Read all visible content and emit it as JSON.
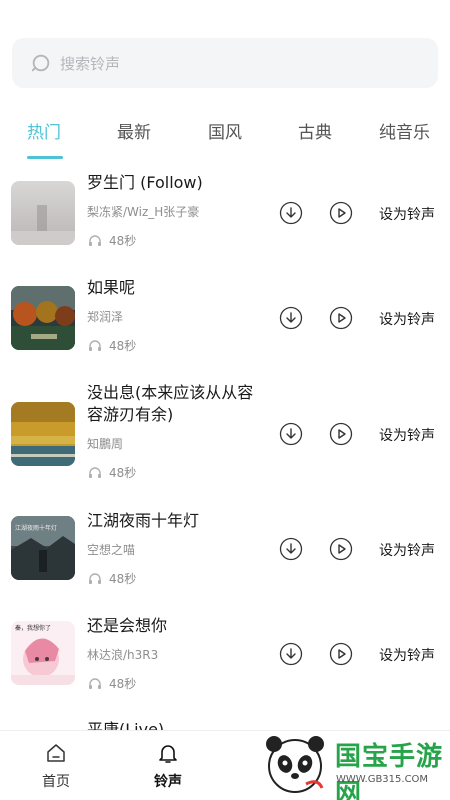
{
  "search": {
    "placeholder": "搜索铃声"
  },
  "tabs": [
    {
      "label": "热门",
      "active": true
    },
    {
      "label": "最新",
      "active": false
    },
    {
      "label": "国风",
      "active": false
    },
    {
      "label": "古典",
      "active": false
    },
    {
      "label": "纯音乐",
      "active": false
    }
  ],
  "songs": [
    {
      "title": "罗生门 (Follow)",
      "artist": "梨冻紧/Wiz_H张子豪",
      "duration": "48秒",
      "action": "设为铃声"
    },
    {
      "title": "如果呢",
      "artist": "郑润泽",
      "duration": "48秒",
      "action": "设为铃声"
    },
    {
      "title": "没出息(本来应该从从容容游刃有余)",
      "artist": "知鵬周",
      "duration": "48秒",
      "action": "设为铃声"
    },
    {
      "title": "江湖夜雨十年灯",
      "artist": "空想之喵",
      "duration": "48秒",
      "action": "设为铃声"
    },
    {
      "title": "还是会想你",
      "artist": "林达浪/h3R3",
      "duration": "48秒",
      "action": "设为铃声"
    }
  ],
  "partial_item": {
    "title": "平康(Live)"
  },
  "cover_text": {
    "song4": "江湖夜雨十年灯",
    "song5": "秦，我想你了"
  },
  "bottom_nav": [
    {
      "label": "首页",
      "icon": "home-icon"
    },
    {
      "label": "铃声",
      "icon": "bell-icon"
    }
  ],
  "watermark": {
    "brand": "国宝手游网",
    "url": "WWW.GB315.COM"
  },
  "colors": {
    "accent": "#4fc3d6",
    "brand_green": "#27a44a"
  }
}
